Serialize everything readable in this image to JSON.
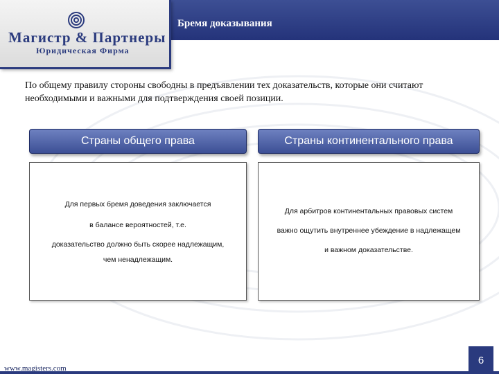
{
  "header": {
    "title": "Бремя доказывания"
  },
  "logo": {
    "name": "Магистр & Партнеры",
    "subtitle": "Юридическая Фирма"
  },
  "intro": "По общему правилу стороны свободны в предъявлении тех доказательств, которые они считают необходимыми и важными для подтверждения своей позиции.",
  "columns": [
    {
      "title": "Страны общего права",
      "lines": [
        "Для первых бремя доведения заключается",
        "в балансе вероятностей, т.е.",
        "доказательство должно быть скорее надлежащим,",
        "чем ненадлежащим."
      ]
    },
    {
      "title": "Страны континентального права",
      "lines": [
        "Для арбитров континентальных правовых систем",
        "важно ощутить внутреннее убеждение в надлежащем",
        "и важном доказательстве."
      ]
    }
  ],
  "footer": {
    "website": "www.magisters.com",
    "page_number": "6"
  },
  "colors": {
    "brand_blue": "#2b3b7e",
    "header_gradient_top": "#3d4f94",
    "column_header": "#4a5ea5"
  }
}
